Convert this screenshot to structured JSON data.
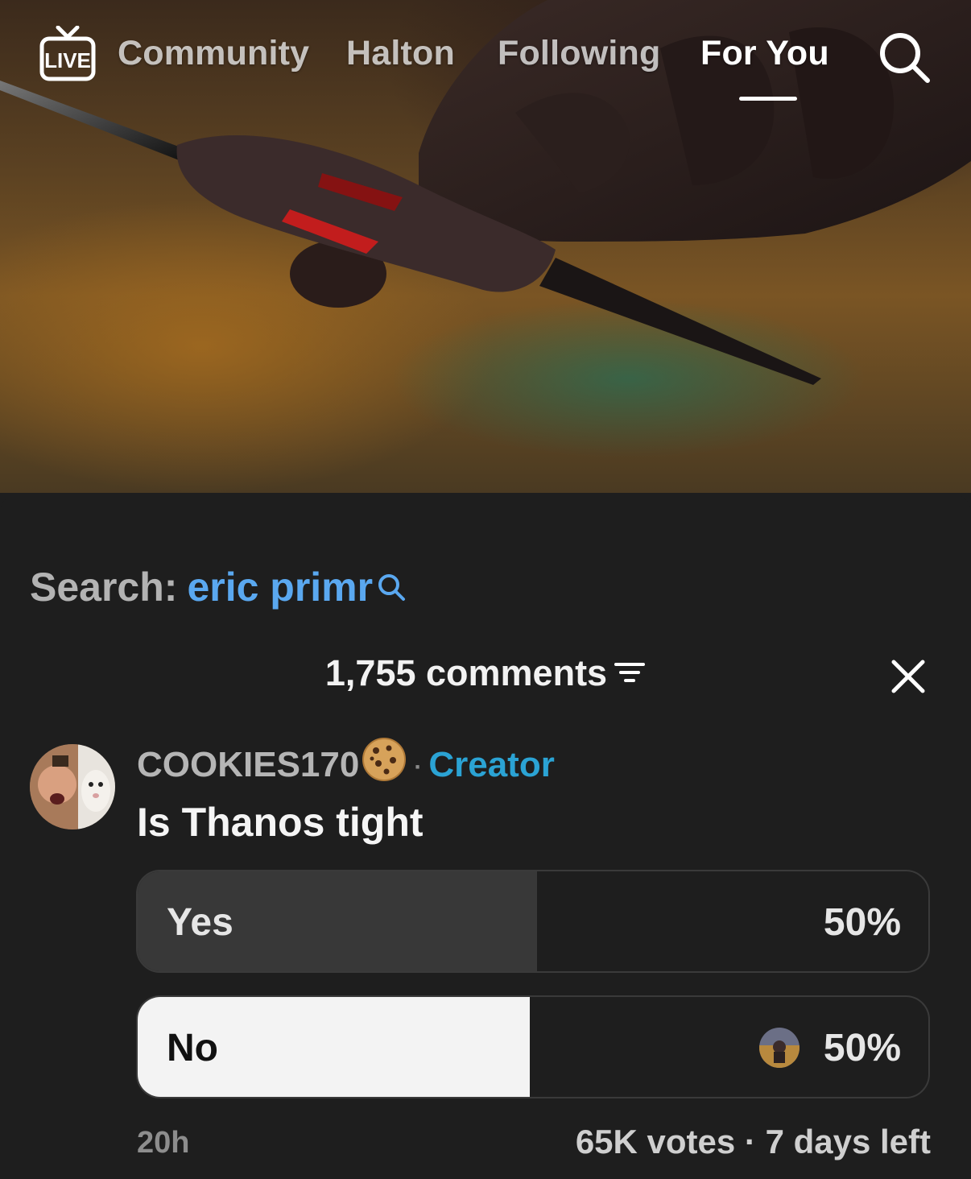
{
  "nav": {
    "live_label": "LIVE",
    "tabs": [
      {
        "label": "Community",
        "active": false
      },
      {
        "label": "Halton",
        "active": false
      },
      {
        "label": "Following",
        "active": false
      },
      {
        "label": "For You",
        "active": true
      }
    ],
    "search_icon": "search-icon"
  },
  "search_suggestion": {
    "prefix": "Search:",
    "term": "eric primr",
    "term_color": "#5aa8f0"
  },
  "comments": {
    "header": "1,755 comments",
    "filter_icon": "filter-icon",
    "close_icon": "close-icon"
  },
  "comment": {
    "username": "COOKIES170",
    "username_emoji": "cookie-emoji",
    "separator": "·",
    "badge": "Creator",
    "badge_color": "#2ba3d4",
    "text": "Is Thanos tight",
    "poll": {
      "options": [
        {
          "label": "Yes",
          "percent_label": "50%",
          "percent": 50,
          "selected": false
        },
        {
          "label": "No",
          "percent_label": "50%",
          "percent": 50,
          "selected": true
        }
      ]
    },
    "time": "20h",
    "votes_summary": "65K votes · 7 days left"
  }
}
